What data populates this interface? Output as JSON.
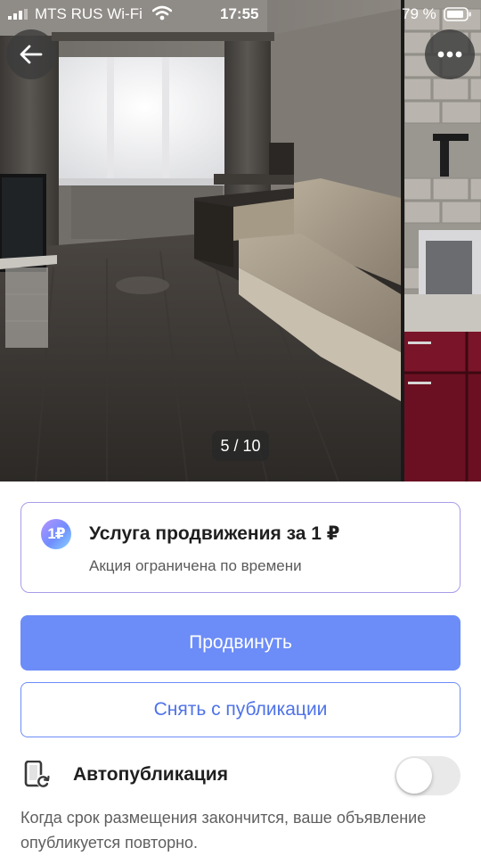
{
  "status_bar": {
    "carrier": "MTS RUS Wi-Fi",
    "time": "17:55",
    "battery_percent": "79 %",
    "icons": [
      "signal-icon",
      "wifi-icon",
      "battery-icon"
    ]
  },
  "gallery": {
    "counter": "5 / 10",
    "current_index": 5,
    "total": 10,
    "back_icon": "arrow-left-icon",
    "more_icon": "more-horizontal-icon"
  },
  "promo": {
    "badge": "1₽",
    "title": "Услуга продвижения за 1 ₽",
    "subtitle": "Акция ограничена по времени"
  },
  "actions": {
    "promote_label": "Продвинуть",
    "unpublish_label": "Снять с публикации"
  },
  "autopublish": {
    "icon": "auto-republish-icon",
    "label": "Автопубликация",
    "enabled": false,
    "hint": "Когда срок размещения закончится, ваше объявление опубликуется повторно."
  },
  "colors": {
    "primary": "#6c8cf7",
    "promo_border": "#a89ce8",
    "toggle_off": "#e9e9ea"
  }
}
